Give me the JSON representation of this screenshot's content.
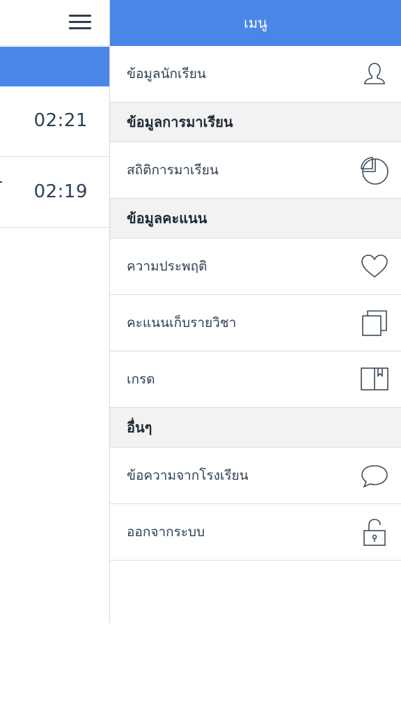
{
  "background": {
    "times": [
      "02:21",
      "02:19"
    ]
  },
  "drawer": {
    "title": "เมนู",
    "items": [
      {
        "label": "ข้อมูลนักเรียน",
        "icon": "user-icon"
      },
      {
        "section": "ข้อมูลการมาเรียน"
      },
      {
        "label": "สถิติการมาเรียน",
        "icon": "pie-chart-icon"
      },
      {
        "section": "ข้อมูลคะแนน"
      },
      {
        "label": "ความประพฤติ",
        "icon": "heart-icon"
      },
      {
        "label": "คะแนนเก็บรายวิชา",
        "icon": "copy-icon"
      },
      {
        "label": "เกรด",
        "icon": "book-icon"
      },
      {
        "section": "อื่นๆ"
      },
      {
        "label": "ข้อความจากโรงเรียน",
        "icon": "chat-bubble-icon"
      },
      {
        "label": "ออกจากระบบ",
        "icon": "unlock-icon"
      }
    ]
  },
  "colors": {
    "accent": "#4a86e8",
    "section_bg": "#f2f2f2",
    "text": "#2f4052"
  }
}
